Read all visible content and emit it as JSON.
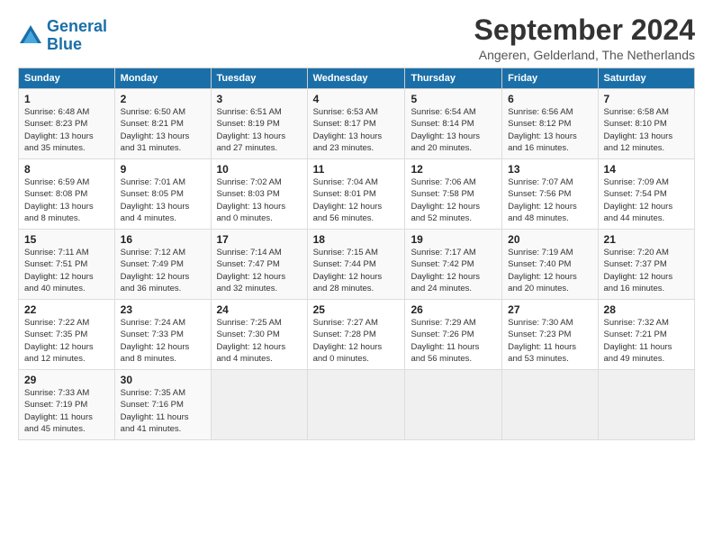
{
  "logo": {
    "line1": "General",
    "line2": "Blue"
  },
  "title": "September 2024",
  "location": "Angeren, Gelderland, The Netherlands",
  "days_header": [
    "Sunday",
    "Monday",
    "Tuesday",
    "Wednesday",
    "Thursday",
    "Friday",
    "Saturday"
  ],
  "weeks": [
    [
      {
        "day": "1",
        "info": "Sunrise: 6:48 AM\nSunset: 8:23 PM\nDaylight: 13 hours\nand 35 minutes."
      },
      {
        "day": "2",
        "info": "Sunrise: 6:50 AM\nSunset: 8:21 PM\nDaylight: 13 hours\nand 31 minutes."
      },
      {
        "day": "3",
        "info": "Sunrise: 6:51 AM\nSunset: 8:19 PM\nDaylight: 13 hours\nand 27 minutes."
      },
      {
        "day": "4",
        "info": "Sunrise: 6:53 AM\nSunset: 8:17 PM\nDaylight: 13 hours\nand 23 minutes."
      },
      {
        "day": "5",
        "info": "Sunrise: 6:54 AM\nSunset: 8:14 PM\nDaylight: 13 hours\nand 20 minutes."
      },
      {
        "day": "6",
        "info": "Sunrise: 6:56 AM\nSunset: 8:12 PM\nDaylight: 13 hours\nand 16 minutes."
      },
      {
        "day": "7",
        "info": "Sunrise: 6:58 AM\nSunset: 8:10 PM\nDaylight: 13 hours\nand 12 minutes."
      }
    ],
    [
      {
        "day": "8",
        "info": "Sunrise: 6:59 AM\nSunset: 8:08 PM\nDaylight: 13 hours\nand 8 minutes."
      },
      {
        "day": "9",
        "info": "Sunrise: 7:01 AM\nSunset: 8:05 PM\nDaylight: 13 hours\nand 4 minutes."
      },
      {
        "day": "10",
        "info": "Sunrise: 7:02 AM\nSunset: 8:03 PM\nDaylight: 13 hours\nand 0 minutes."
      },
      {
        "day": "11",
        "info": "Sunrise: 7:04 AM\nSunset: 8:01 PM\nDaylight: 12 hours\nand 56 minutes."
      },
      {
        "day": "12",
        "info": "Sunrise: 7:06 AM\nSunset: 7:58 PM\nDaylight: 12 hours\nand 52 minutes."
      },
      {
        "day": "13",
        "info": "Sunrise: 7:07 AM\nSunset: 7:56 PM\nDaylight: 12 hours\nand 48 minutes."
      },
      {
        "day": "14",
        "info": "Sunrise: 7:09 AM\nSunset: 7:54 PM\nDaylight: 12 hours\nand 44 minutes."
      }
    ],
    [
      {
        "day": "15",
        "info": "Sunrise: 7:11 AM\nSunset: 7:51 PM\nDaylight: 12 hours\nand 40 minutes."
      },
      {
        "day": "16",
        "info": "Sunrise: 7:12 AM\nSunset: 7:49 PM\nDaylight: 12 hours\nand 36 minutes."
      },
      {
        "day": "17",
        "info": "Sunrise: 7:14 AM\nSunset: 7:47 PM\nDaylight: 12 hours\nand 32 minutes."
      },
      {
        "day": "18",
        "info": "Sunrise: 7:15 AM\nSunset: 7:44 PM\nDaylight: 12 hours\nand 28 minutes."
      },
      {
        "day": "19",
        "info": "Sunrise: 7:17 AM\nSunset: 7:42 PM\nDaylight: 12 hours\nand 24 minutes."
      },
      {
        "day": "20",
        "info": "Sunrise: 7:19 AM\nSunset: 7:40 PM\nDaylight: 12 hours\nand 20 minutes."
      },
      {
        "day": "21",
        "info": "Sunrise: 7:20 AM\nSunset: 7:37 PM\nDaylight: 12 hours\nand 16 minutes."
      }
    ],
    [
      {
        "day": "22",
        "info": "Sunrise: 7:22 AM\nSunset: 7:35 PM\nDaylight: 12 hours\nand 12 minutes."
      },
      {
        "day": "23",
        "info": "Sunrise: 7:24 AM\nSunset: 7:33 PM\nDaylight: 12 hours\nand 8 minutes."
      },
      {
        "day": "24",
        "info": "Sunrise: 7:25 AM\nSunset: 7:30 PM\nDaylight: 12 hours\nand 4 minutes."
      },
      {
        "day": "25",
        "info": "Sunrise: 7:27 AM\nSunset: 7:28 PM\nDaylight: 12 hours\nand 0 minutes."
      },
      {
        "day": "26",
        "info": "Sunrise: 7:29 AM\nSunset: 7:26 PM\nDaylight: 11 hours\nand 56 minutes."
      },
      {
        "day": "27",
        "info": "Sunrise: 7:30 AM\nSunset: 7:23 PM\nDaylight: 11 hours\nand 53 minutes."
      },
      {
        "day": "28",
        "info": "Sunrise: 7:32 AM\nSunset: 7:21 PM\nDaylight: 11 hours\nand 49 minutes."
      }
    ],
    [
      {
        "day": "29",
        "info": "Sunrise: 7:33 AM\nSunset: 7:19 PM\nDaylight: 11 hours\nand 45 minutes."
      },
      {
        "day": "30",
        "info": "Sunrise: 7:35 AM\nSunset: 7:16 PM\nDaylight: 11 hours\nand 41 minutes."
      },
      {
        "day": "",
        "info": ""
      },
      {
        "day": "",
        "info": ""
      },
      {
        "day": "",
        "info": ""
      },
      {
        "day": "",
        "info": ""
      },
      {
        "day": "",
        "info": ""
      }
    ]
  ]
}
